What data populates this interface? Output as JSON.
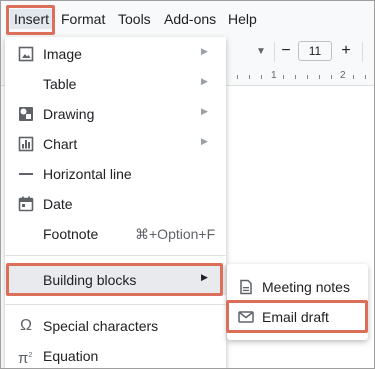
{
  "menubar": {
    "items": [
      {
        "label": "Insert"
      },
      {
        "label": "Format"
      },
      {
        "label": "Tools"
      },
      {
        "label": "Add-ons"
      },
      {
        "label": "Help"
      }
    ]
  },
  "toolbar": {
    "minus": "−",
    "font_size": "11",
    "plus": "+"
  },
  "ruler": {
    "marks": [
      "1",
      "2"
    ]
  },
  "insert_menu": {
    "items": [
      {
        "label": "Image",
        "icon": "image-icon",
        "has_submenu": true
      },
      {
        "label": "Table",
        "has_submenu": true
      },
      {
        "label": "Drawing",
        "icon": "drawing-icon",
        "has_submenu": true
      },
      {
        "label": "Chart",
        "icon": "chart-icon",
        "has_submenu": true
      },
      {
        "label": "Horizontal line",
        "icon": "horizontal-line-icon"
      },
      {
        "label": "Date",
        "icon": "calendar-icon"
      },
      {
        "label": "Footnote",
        "shortcut": "⌘+Option+F"
      },
      {
        "label": "Building blocks",
        "has_submenu": true,
        "selected": true
      },
      {
        "label": "Special characters",
        "icon": "omega-icon"
      },
      {
        "label": "Equation",
        "icon": "pi-icon"
      }
    ]
  },
  "building_blocks_submenu": {
    "items": [
      {
        "label": "Meeting notes",
        "icon": "document-icon"
      },
      {
        "label": "Email draft",
        "icon": "email-draft-icon"
      }
    ]
  },
  "colors": {
    "highlight": "#dc6f5a",
    "selected_row": "#e8eaed"
  }
}
